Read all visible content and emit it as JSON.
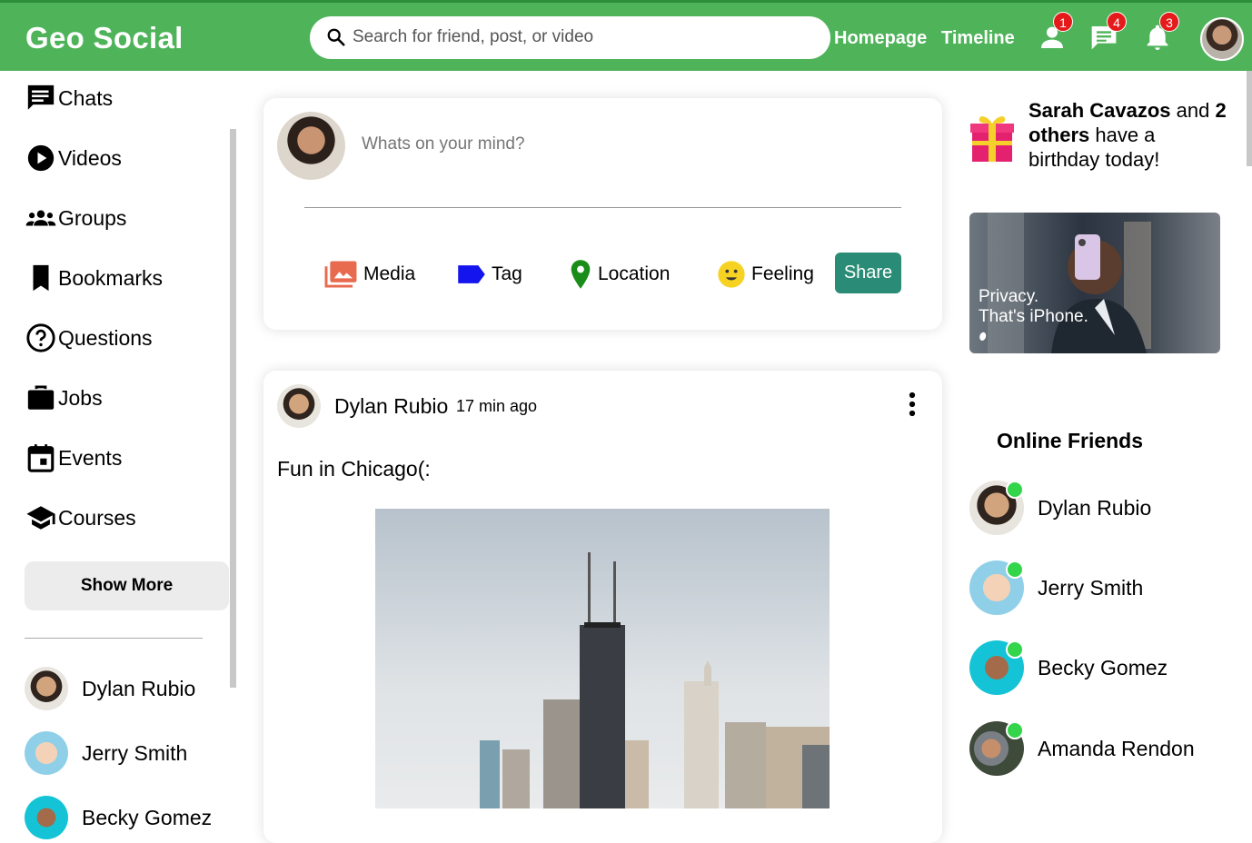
{
  "app": {
    "logo": "Geo Social"
  },
  "search": {
    "placeholder": "Search for friend, post, or video"
  },
  "nav": {
    "homepage": "Homepage",
    "timeline": "Timeline"
  },
  "notifications": {
    "friends": "1",
    "messages": "4",
    "alerts": "3"
  },
  "sidebar": {
    "items": [
      {
        "label": "Chats",
        "icon": "chat-icon"
      },
      {
        "label": "Videos",
        "icon": "play-icon"
      },
      {
        "label": "Groups",
        "icon": "groups-icon"
      },
      {
        "label": "Bookmarks",
        "icon": "bookmark-icon"
      },
      {
        "label": "Questions",
        "icon": "question-icon"
      },
      {
        "label": "Jobs",
        "icon": "briefcase-icon"
      },
      {
        "label": "Events",
        "icon": "calendar-icon"
      },
      {
        "label": "Courses",
        "icon": "school-icon"
      }
    ],
    "show_more": "Show More",
    "friends": [
      "Dylan Rubio",
      "Jerry Smith",
      "Becky Gomez"
    ]
  },
  "composer": {
    "placeholder": "Whats on your mind?",
    "options": {
      "media": "Media",
      "tag": "Tag",
      "location": "Location",
      "feeling": "Feeling"
    },
    "share": "Share"
  },
  "post": {
    "author": "Dylan Rubio",
    "time": "17 min ago",
    "text": "Fun in Chicago(:"
  },
  "birthday": {
    "name": "Sarah Cavazos",
    "and": " and ",
    "count": "2 others",
    "rest": " have a birthday today!"
  },
  "ad": {
    "line1": "Privacy.",
    "line2": "That's iPhone."
  },
  "online": {
    "title": "Online Friends",
    "friends": [
      "Dylan Rubio",
      "Jerry Smith",
      "Becky Gomez",
      "Amanda Rendon"
    ]
  },
  "colors": {
    "header": "#4fb35a",
    "share": "#2a8c76",
    "badge": "#e51b1b",
    "online": "#33d54b"
  }
}
